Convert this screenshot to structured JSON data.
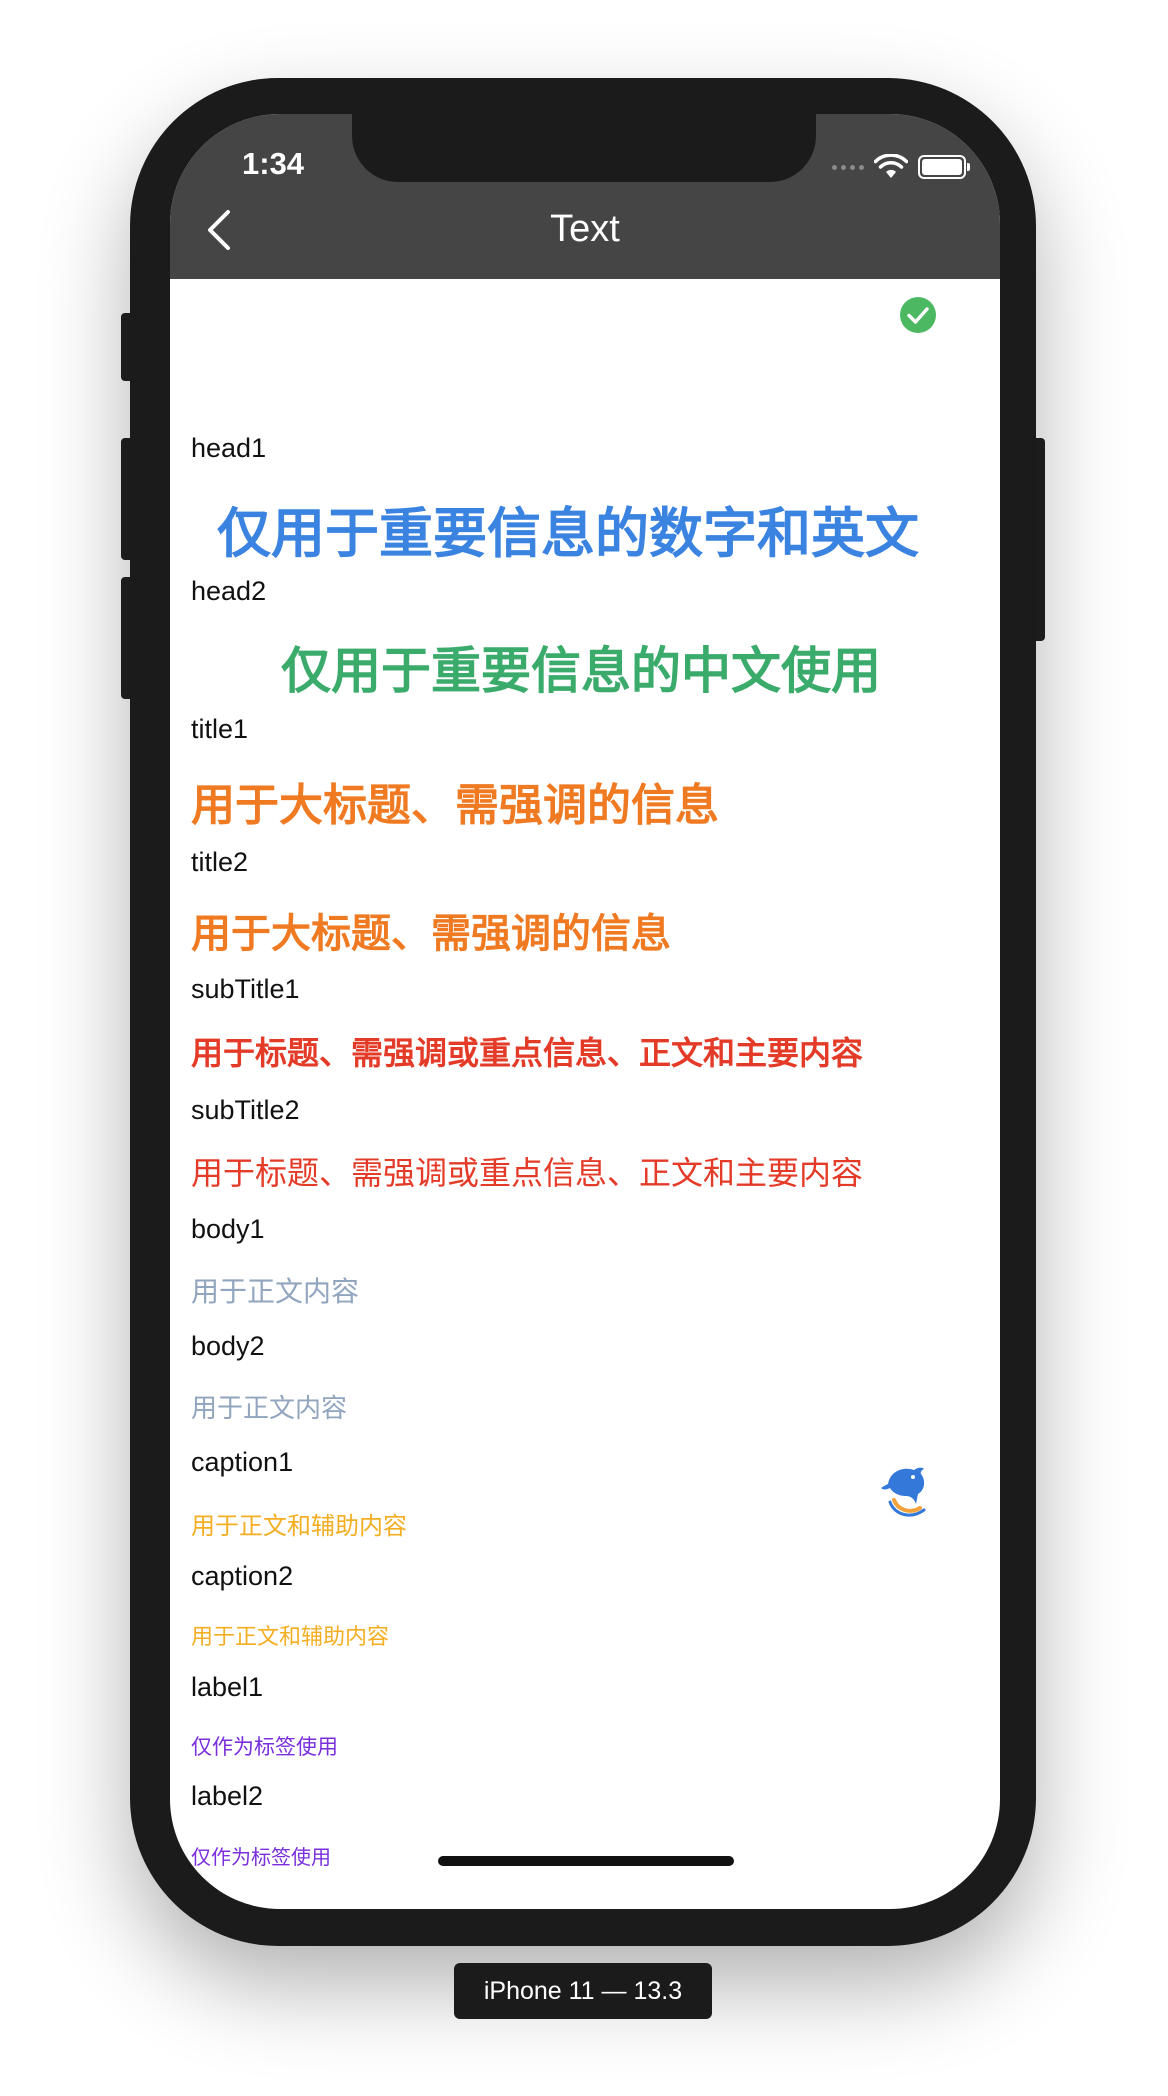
{
  "status_bar": {
    "time": "1:34"
  },
  "nav": {
    "title": "Text"
  },
  "items": [
    {
      "label": "head1",
      "sample": "仅用于重要信息的数字和英文",
      "color": "#3a83e0"
    },
    {
      "label": "head2",
      "sample": "仅用于重要信息的中文使用",
      "color": "#3bab6c"
    },
    {
      "label": "title1",
      "sample": "用于大标题、需强调的信息",
      "color": "#ef7a22"
    },
    {
      "label": "title2",
      "sample": "用于大标题、需强调的信息",
      "color": "#ef7a22"
    },
    {
      "label": "subTitle1",
      "sample": "用于标题、需强调或重点信息、正文和主要内容",
      "color": "#e43b28"
    },
    {
      "label": "subTitle2",
      "sample": "用于标题、需强调或重点信息、正文和主要内容",
      "color": "#e43b28"
    },
    {
      "label": "body1",
      "sample": "用于正文内容",
      "color": "#91a5bf"
    },
    {
      "label": "body2",
      "sample": "用于正文内容",
      "color": "#91a5bf"
    },
    {
      "label": "caption1",
      "sample": "用于正文和辅助内容",
      "color": "#f3ae22"
    },
    {
      "label": "caption2",
      "sample": "用于正文和辅助内容",
      "color": "#f3ae22"
    },
    {
      "label": "label1",
      "sample": "仅作为标签使用",
      "color": "#7a2fdc"
    },
    {
      "label": "label2",
      "sample": "仅作为标签使用",
      "color": "#7a2fdc"
    }
  ],
  "icons": {
    "back": "chevron-left-icon",
    "check": "check-circle-icon",
    "floating": "dolphin-logo-icon"
  },
  "device": {
    "label": "iPhone 11 — 13.3"
  }
}
